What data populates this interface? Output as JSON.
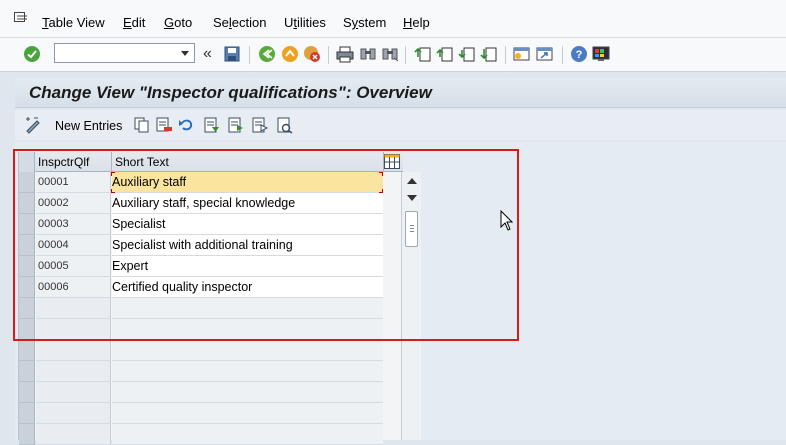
{
  "menubar": {
    "items": [
      {
        "label": "Table View",
        "underline": "T"
      },
      {
        "label": "Edit",
        "underline": "E"
      },
      {
        "label": "Goto",
        "underline": "G"
      },
      {
        "label": "Selection",
        "underline": "l"
      },
      {
        "label": "Utilities",
        "underline": "t"
      },
      {
        "label": "System",
        "underline": "y"
      },
      {
        "label": "Help",
        "underline": "H"
      }
    ]
  },
  "toolbar": {
    "command_field": {
      "value": "",
      "placeholder": ""
    },
    "icons": [
      "enter-icon",
      "save-icon",
      "back-icon",
      "exit-icon",
      "cancel-icon",
      "print-icon",
      "find-icon",
      "find-next-icon",
      "first-page-icon",
      "previous-page-icon",
      "next-page-icon",
      "last-page-icon",
      "create-session-icon",
      "shortcut-icon",
      "help-icon",
      "customize-layout-icon"
    ]
  },
  "title": "Change View \"Inspector qualifications\": Overview",
  "app_toolbar": {
    "new_entries_label": "New Entries",
    "icons": [
      "display-change-icon",
      "copy-icon",
      "delete-icon",
      "undo-icon",
      "select-all-icon",
      "select-block-icon",
      "deselect-all-icon",
      "print-field-icon"
    ]
  },
  "table": {
    "columns": [
      "InspctrQlf",
      "Short Text"
    ],
    "rows": [
      {
        "code": "00001",
        "text": "Auxiliary staff"
      },
      {
        "code": "00002",
        "text": "Auxiliary staff, special knowledge"
      },
      {
        "code": "00003",
        "text": "Specialist"
      },
      {
        "code": "00004",
        "text": "Specialist with additional training"
      },
      {
        "code": "00005",
        "text": "Expert"
      },
      {
        "code": "00006",
        "text": "Certified quality inspector"
      }
    ],
    "empty_rows": 7,
    "active_row_index": 0
  },
  "colors": {
    "highlight_frame": "#d41c1c",
    "active_row": "#fbe49d",
    "background": "#dfe6ee"
  }
}
